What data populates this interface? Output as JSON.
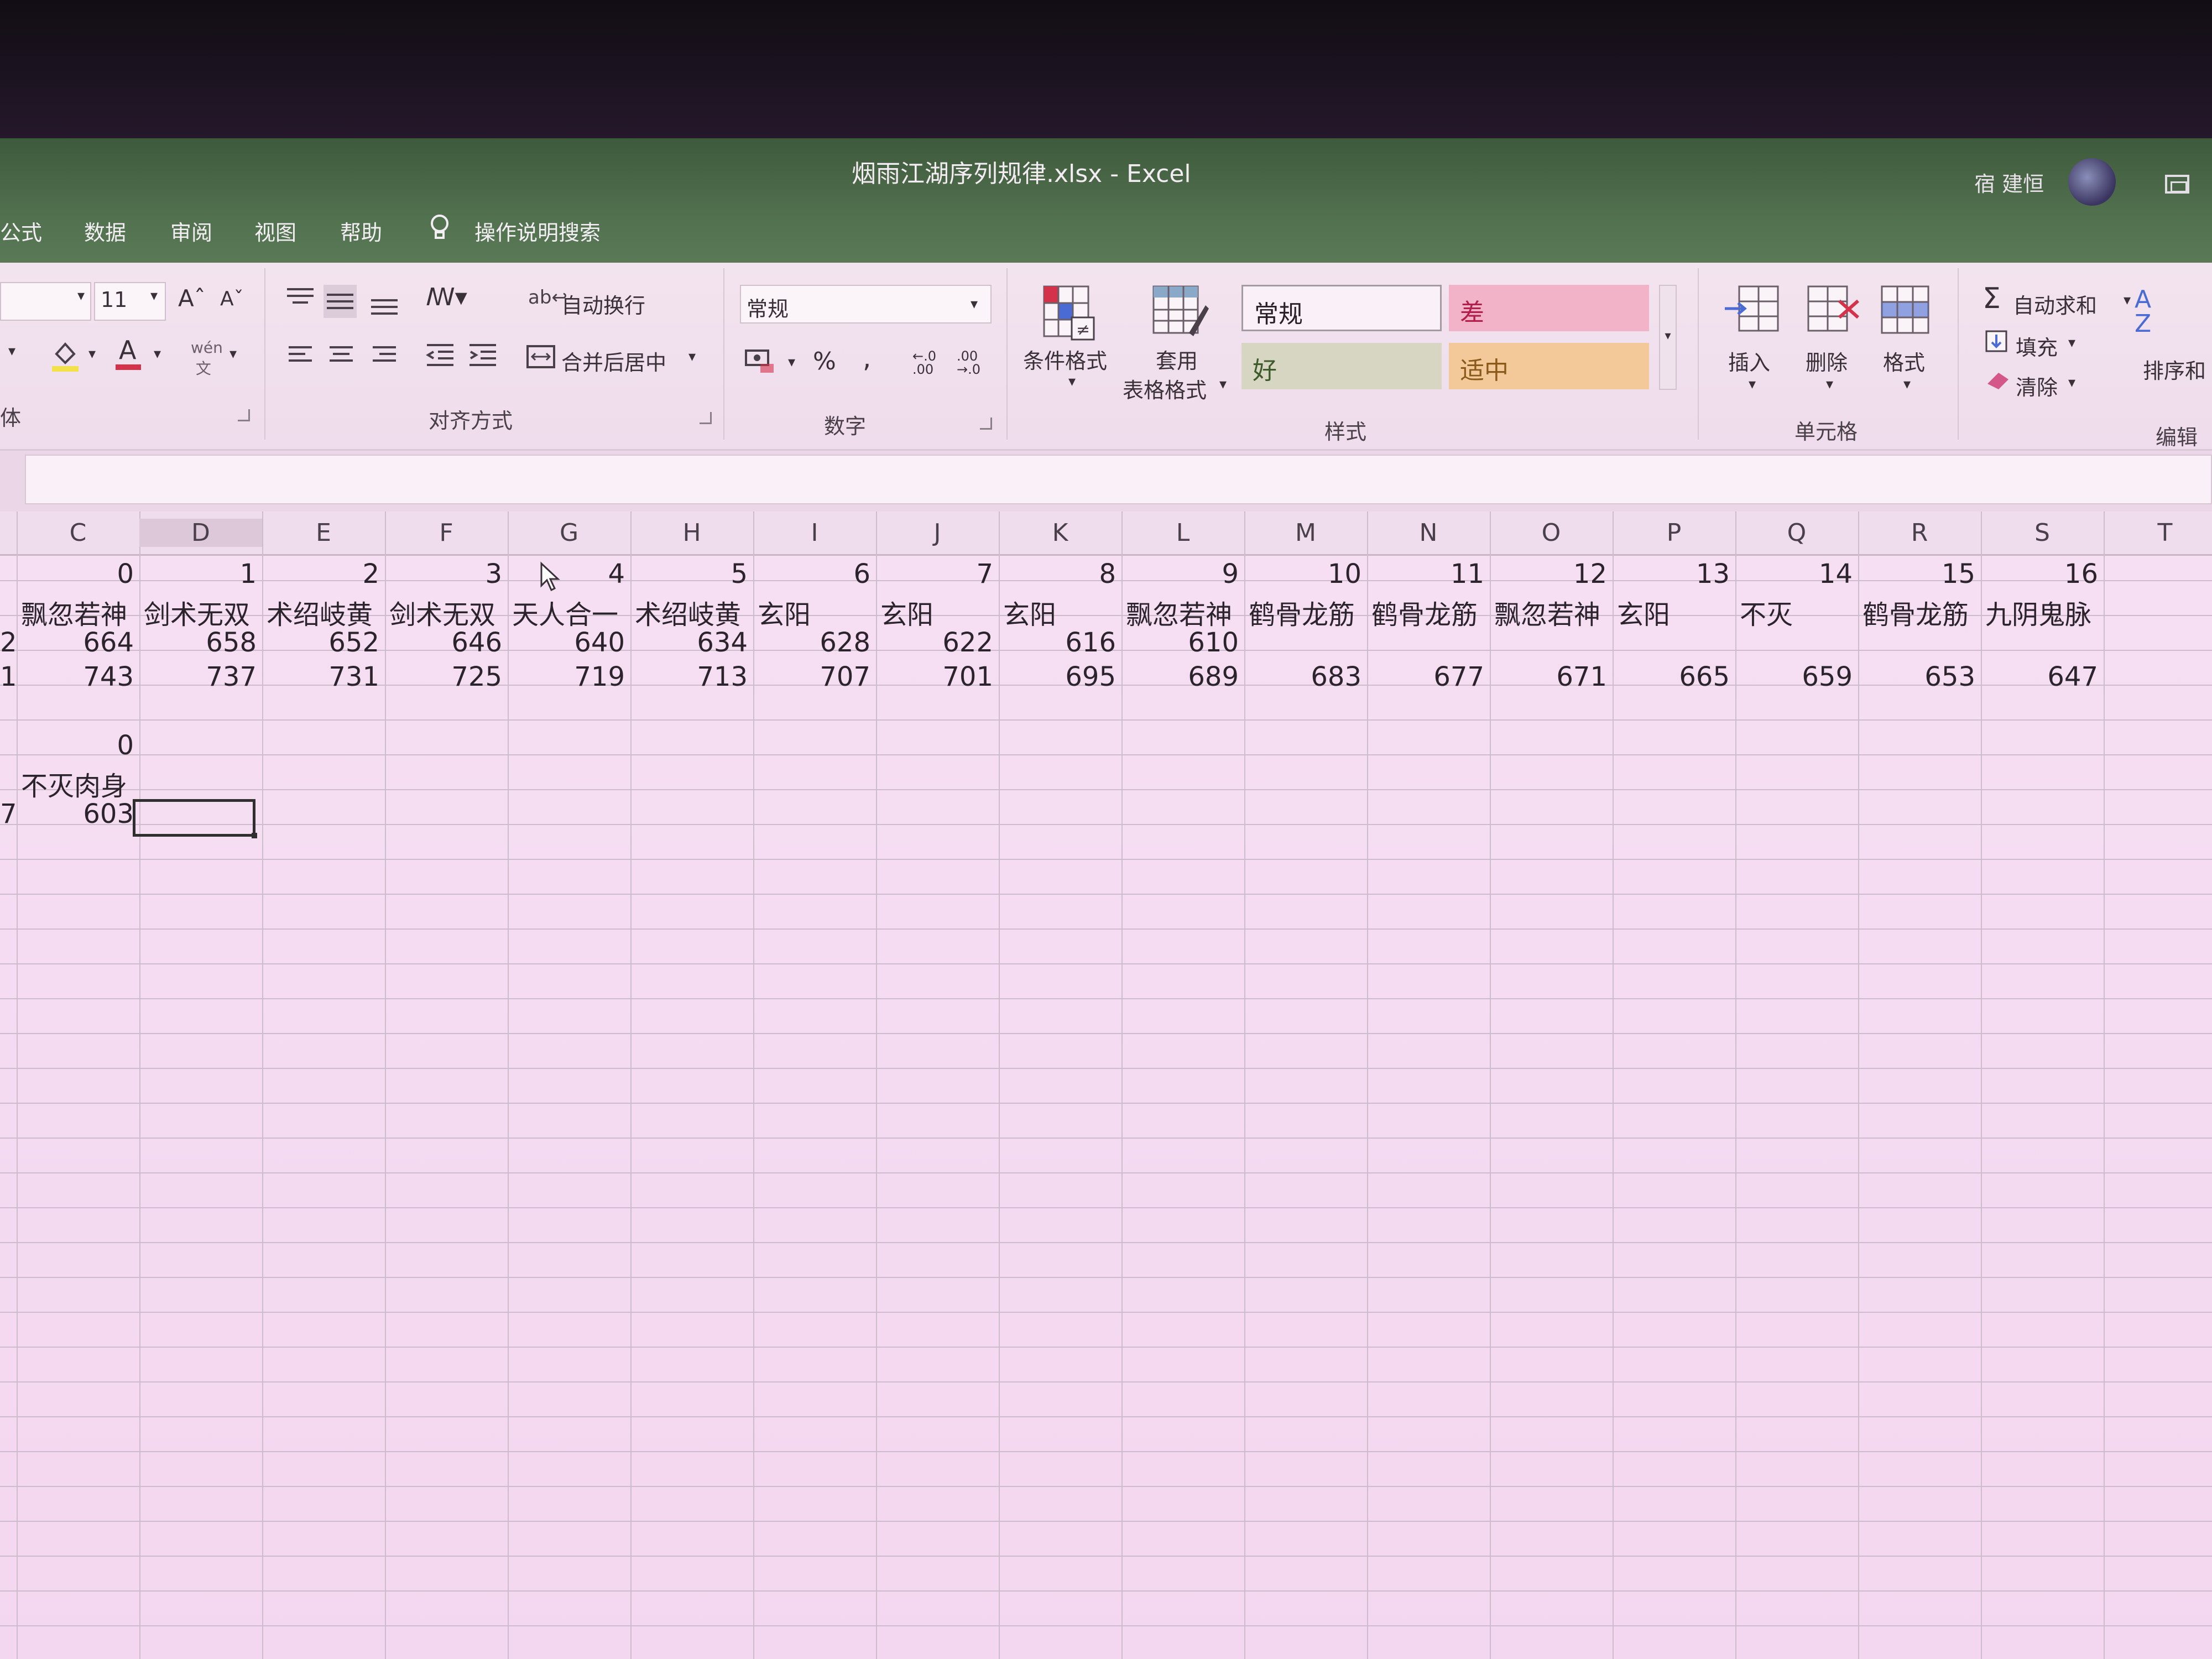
{
  "window": {
    "title": "烟雨江湖序列规律.xlsx  -  Excel",
    "user": "宿 建恒"
  },
  "tabs": [
    "公式",
    "数据",
    "审阅",
    "视图",
    "帮助",
    "操作说明搜索"
  ],
  "ribbon": {
    "font": {
      "size": "11",
      "group_label": "字体",
      "label_fragment": "体"
    },
    "alignment": {
      "wrap_text": "自动换行",
      "merge_center": "合并后居中",
      "group_label": "对齐方式"
    },
    "number": {
      "format": "常规",
      "percent": "%",
      "comma": ",",
      "group_label": "数字"
    },
    "styles": {
      "conditional": "条件格式",
      "table_format_line1": "套用",
      "table_format_line2": "表格格式",
      "normal": "常规",
      "bad": "差",
      "good": "好",
      "neutral": "适中",
      "group_label": "样式",
      "colors": {
        "normal": "#f9f1f7",
        "bad": "#f2b3c8",
        "good": "#d6d6c2",
        "neutral": "#f3c99a"
      }
    },
    "cells": {
      "insert": "插入",
      "delete": "删除",
      "format": "格式",
      "group_label": "单元格"
    },
    "editing": {
      "autosum": "自动求和",
      "fill": "填充",
      "clear": "清除",
      "sort": "排序和",
      "group_label": "编辑"
    }
  },
  "columns": [
    "C",
    "D",
    "E",
    "F",
    "G",
    "H",
    "I",
    "J",
    "K",
    "L",
    "M",
    "N",
    "O",
    "P",
    "Q",
    "R",
    "S",
    "T"
  ],
  "rows": {
    "index": [
      "0",
      "1",
      "2",
      "3",
      "4",
      "5",
      "6",
      "7",
      "8",
      "9",
      "10",
      "11",
      "12",
      "13",
      "14",
      "15",
      "16"
    ],
    "names": [
      "飘忽若神",
      "剑术无双",
      "术绍岐黄",
      "剑术无双",
      "天人合一",
      "术绍岐黄",
      "玄阳",
      "玄阳",
      "玄阳",
      "飘忽若神",
      "鹤骨龙筋",
      "鹤骨龙筋",
      "飘忽若神",
      "玄阳",
      "不灭",
      "鹤骨龙筋",
      "九阴鬼脉"
    ],
    "values_a": [
      "664",
      "658",
      "652",
      "646",
      "640",
      "634",
      "628",
      "622",
      "616",
      "610"
    ],
    "values_b": [
      "743",
      "737",
      "731",
      "725",
      "719",
      "713",
      "707",
      "701",
      "695",
      "689",
      "683",
      "677",
      "671",
      "665",
      "659",
      "653",
      "647"
    ],
    "row_prefix": [
      "2",
      "1",
      "7"
    ],
    "second_block": {
      "index": "0",
      "name": "不灭肉身",
      "value": "603"
    }
  }
}
